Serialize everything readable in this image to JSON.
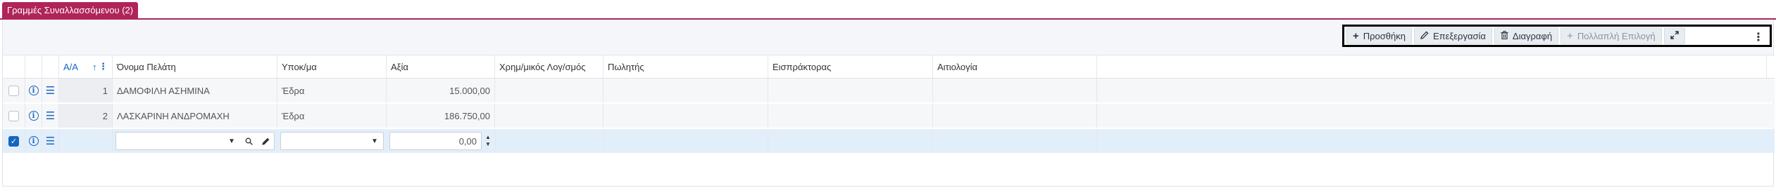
{
  "tab": {
    "title": "Γραμμές Συναλλασσόμενου (2)"
  },
  "toolbar": {
    "add_label": "Προσθήκη",
    "edit_label": "Επεξεργασία",
    "delete_label": "Διαγραφή",
    "multi_select_label": "Πολλαπλή Επιλογή",
    "add_icon": "plus-icon",
    "edit_icon": "pencil-icon",
    "delete_icon": "trash-icon",
    "multi_icon": "plus-icon",
    "expand_icon": "expand-icon",
    "more_icon": "kebab-icon"
  },
  "columns": {
    "aa": "Α/Α",
    "customer_name": "Όνομα Πελάτη",
    "branch": "Υποκ/μα",
    "value": "Αξία",
    "account": "Χρημ/μικός Λογ/σμός",
    "seller": "Πωλητής",
    "collector": "Εισπράκτορας",
    "reason": "Αιτιολογία"
  },
  "rows": [
    {
      "aa": "1",
      "customer_name": "ΔΑΜΟΦΙΛΗ ΑΣΗΜΙΝΑ",
      "branch": "Έδρα",
      "value": "15.000,00",
      "account": "",
      "seller": "",
      "collector": "",
      "reason": "",
      "checked": false
    },
    {
      "aa": "2",
      "customer_name": "ΛΑΣΚΑΡΙΝΗ ΑΝΔΡΟΜΑΧΗ",
      "branch": "Έδρα",
      "value": "186.750,00",
      "account": "",
      "seller": "",
      "collector": "",
      "reason": "",
      "checked": false
    }
  ],
  "new_row": {
    "customer_name": "",
    "branch": "",
    "value": "0,00",
    "checked": true
  },
  "colors": {
    "accent": "#b0245a",
    "primary": "#1565c0",
    "editing_row": "#e3eefb"
  }
}
